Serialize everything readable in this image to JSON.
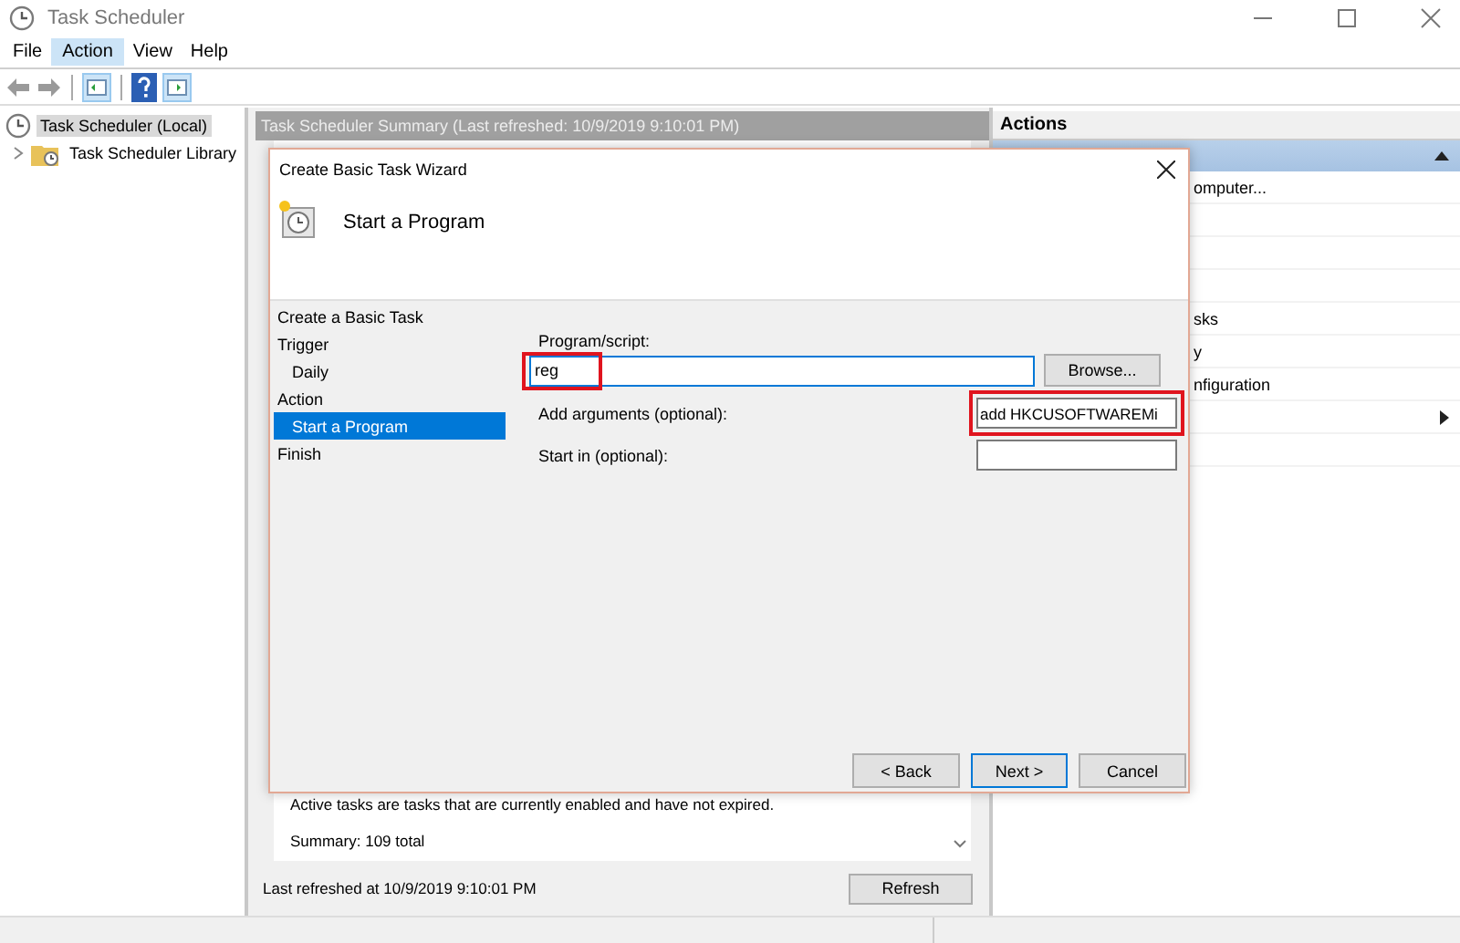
{
  "window": {
    "title": "Task Scheduler"
  },
  "menu": [
    {
      "label": "File",
      "selected": false
    },
    {
      "label": "Action",
      "selected": true
    },
    {
      "label": "View",
      "selected": false
    },
    {
      "label": "Help",
      "selected": false
    }
  ],
  "tree": [
    {
      "label": "Task Scheduler (Local)",
      "selected": true,
      "children": [
        {
          "label": "Task Scheduler Library",
          "selected": false,
          "expanded": false
        }
      ]
    }
  ],
  "summary": {
    "title": "Task Scheduler Summary (Last refreshed: 10/9/2019 9:10:01 PM)",
    "lines": [
      "Active tasks are tasks that are currently enabled and have not expired.",
      "Summary: 109 total"
    ],
    "footer": "Last refreshed at 10/9/2019 9:10:01 PM",
    "refresh": "Refresh"
  },
  "actions": {
    "title": "Actions",
    "items": [
      {
        "kind": "item",
        "label": "omputer..."
      },
      {
        "kind": "blank"
      },
      {
        "kind": "blank"
      },
      {
        "kind": "blank"
      },
      {
        "kind": "item",
        "label": "sks"
      },
      {
        "kind": "item",
        "label": "y"
      },
      {
        "kind": "item",
        "label": "nfiguration"
      },
      {
        "kind": "submenu"
      },
      {
        "kind": "blank"
      }
    ]
  },
  "dialog": {
    "title": "Create Basic Task Wizard",
    "heading": "Start a Program",
    "steps": [
      {
        "kind": "header",
        "label": "Create a Basic Task",
        "selected": false
      },
      {
        "kind": "step",
        "label": "Trigger",
        "selected": false
      },
      {
        "kind": "substep",
        "label": "Daily",
        "selected": false
      },
      {
        "kind": "step",
        "label": "Action",
        "selected": false
      },
      {
        "kind": "substep",
        "label": "Start a Program",
        "selected": true
      },
      {
        "kind": "step",
        "label": "Finish",
        "selected": false
      }
    ],
    "fields": [
      {
        "kind": "wide",
        "label": "Program/script:",
        "value": "reg",
        "focused": true,
        "highlighted": true
      },
      {
        "kind": "inline",
        "label": "Add arguments (optional):",
        "value": "add HKCUSOFTWAREMi",
        "focused": false,
        "highlighted": true
      },
      {
        "kind": "inline",
        "label": "Start in (optional):",
        "focused": false,
        "highlighted": false
      }
    ],
    "browse": "Browse...",
    "buttons": [
      {
        "label": "< Back",
        "default": false
      },
      {
        "label": "Next >",
        "default": true
      },
      {
        "label": "Cancel",
        "default": false
      }
    ]
  }
}
